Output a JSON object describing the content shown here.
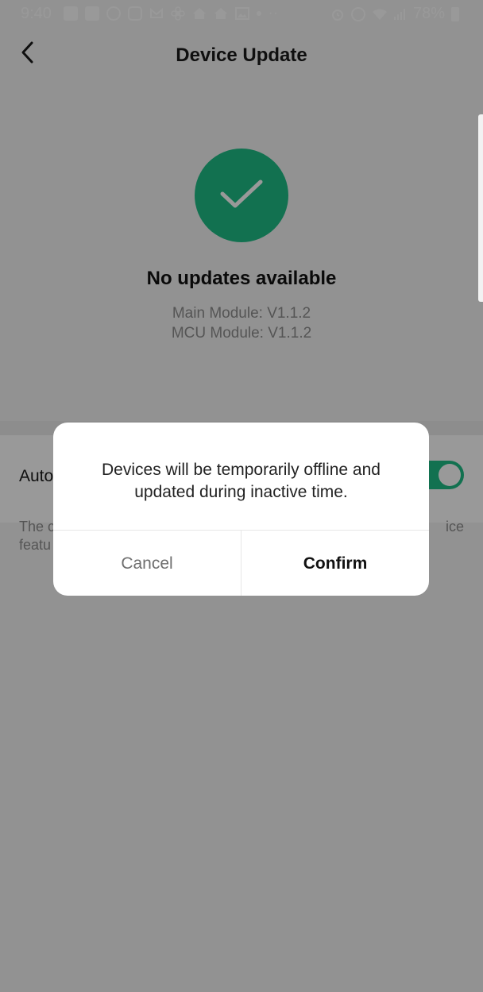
{
  "status_bar": {
    "time": "9:40",
    "battery": "78%",
    "icons": [
      "facebook-icon",
      "facebook-icon",
      "chrome-icon",
      "instagram-icon",
      "gmail-icon",
      "fan-icon",
      "home-icon",
      "home-icon",
      "image-icon",
      "dot-icon",
      "more-icon",
      "alarm-icon",
      "volte-icon",
      "wifi-icon",
      "signal-icon",
      "battery-icon"
    ]
  },
  "header": {
    "title": "Device Update",
    "back_icon": "chevron-left-icon"
  },
  "main": {
    "status_icon": "check-icon",
    "headline": "No updates available",
    "modules": [
      {
        "label": "Main Module: V1.1.2"
      },
      {
        "label": "MCU Module: V1.1.2"
      }
    ],
    "auto_update": {
      "label": "Auto",
      "enabled": true,
      "description_start": "The c",
      "description_end": "ice",
      "description_line2": "featu"
    }
  },
  "dialog": {
    "message": "Devices will be temporarily offline and updated during inactive time.",
    "cancel_label": "Cancel",
    "confirm_label": "Confirm"
  },
  "colors": {
    "accent": "#1fbc85",
    "scrim": "rgba(0,0,0,0.40)"
  }
}
